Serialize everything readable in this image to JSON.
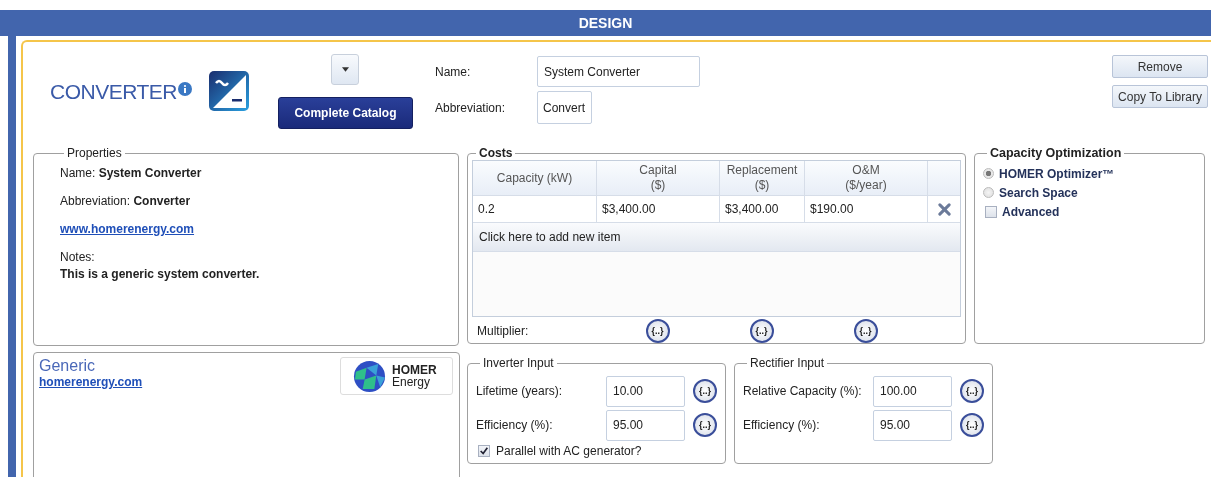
{
  "header": {
    "title": "DESIGN"
  },
  "converter": {
    "title": "CONVERTER",
    "catalog_button": "Complete Catalog",
    "name_label": "Name:",
    "name_value": "System Converter",
    "abbreviation_label": "Abbreviation:",
    "abbreviation_value": "Convert"
  },
  "actions": [
    "Remove",
    "Copy To Library"
  ],
  "properties": {
    "legend": "Properties",
    "name_label": "Name:",
    "name_value": "System Converter",
    "abbreviation_label": "Abbreviation:",
    "abbreviation_value": "Converter",
    "link": "www.homerenergy.com",
    "notes_label": "Notes:",
    "notes": "This is a generic system converter."
  },
  "costs": {
    "legend": "Costs",
    "columns": [
      "Capacity (kW)",
      "Capital ($)",
      "Replacement ($)",
      "O&M ($/year)"
    ],
    "rows": [
      [
        "0.2",
        "$3,400.00",
        "$3,400.00",
        "$190.00"
      ]
    ],
    "add_item": "Click here to add new item",
    "multiplier_label": "Multiplier:",
    "multiplier_buttons": [
      "{..}",
      "{..}",
      "{..}"
    ]
  },
  "capacity_optimization": {
    "legend": "Capacity Optimization",
    "options": [
      {
        "kind": "radio",
        "label": "HOMER Optimizer™",
        "selected": true
      },
      {
        "kind": "radio",
        "label": "Search Space",
        "selected": false
      },
      {
        "kind": "checkbox",
        "label": "Advanced",
        "checked": false
      }
    ]
  },
  "vendor": {
    "name": "Generic",
    "link": "homerenergy.com",
    "logo_lines": [
      "HOMER",
      "Energy"
    ]
  },
  "inverter_input": {
    "legend": "Inverter Input",
    "fields": [
      {
        "label": "Lifetime (years):",
        "value": "10.00",
        "button": "{..}"
      },
      {
        "label": "Efficiency (%):",
        "value": "95.00",
        "button": "{..}"
      }
    ],
    "parallel": {
      "label": "Parallel with AC generator?",
      "checked": true
    }
  },
  "rectifier_input": {
    "legend": "Rectifier Input",
    "fields": [
      {
        "label": "Relative Capacity (%):",
        "value": "100.00",
        "button": "{..}"
      },
      {
        "label": "Efficiency (%):",
        "value": "95.00",
        "button": "{..}"
      }
    ]
  }
}
